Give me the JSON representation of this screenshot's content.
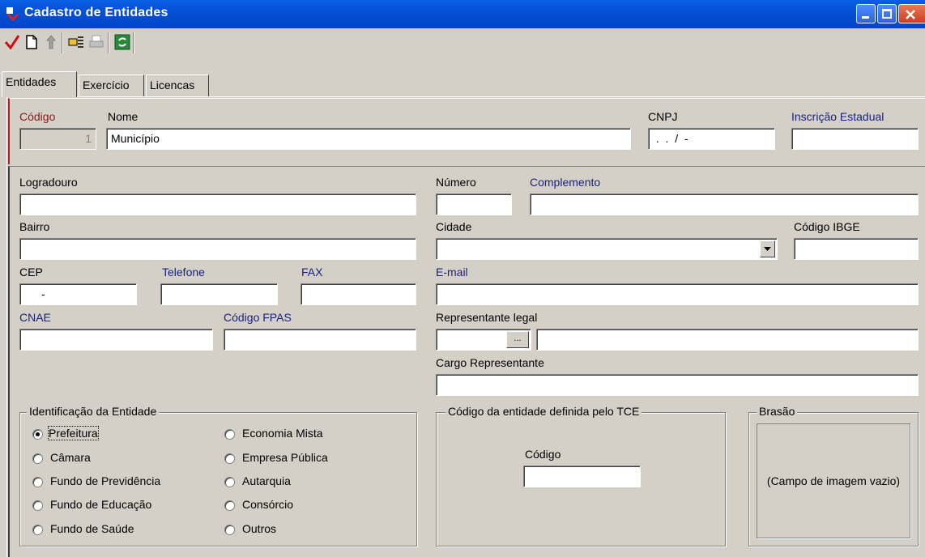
{
  "window": {
    "title": "Cadastro de Entidades",
    "titlebar_color": "#0050d0"
  },
  "toolbar": {
    "icons": [
      "checkmark-icon",
      "new-document-icon",
      "delete-icon",
      "search-icon",
      "print-icon",
      "refresh-icon"
    ]
  },
  "tabs": [
    {
      "label": "Entidades",
      "active": true
    },
    {
      "label": "Exercício",
      "active": false
    },
    {
      "label": "Licencas",
      "active": false
    }
  ],
  "header": {
    "codigo_label": "Código",
    "codigo_value": "1",
    "nome_label": "Nome",
    "nome_value": "Município",
    "cnpj_label": "CNPJ",
    "cnpj_value": " .  .  /  -",
    "ie_label": "Inscrição Estadual",
    "ie_value": ""
  },
  "address": {
    "logradouro_label": "Logradouro",
    "numero_label": "Número",
    "complemento_label": "Complemento",
    "bairro_label": "Bairro",
    "cidade_label": "Cidade",
    "ibge_label": "Código IBGE",
    "cep_label": "CEP",
    "cep_value": "-",
    "telefone_label": "Telefone",
    "fax_label": "FAX",
    "email_label": "E-mail",
    "cnae_label": "CNAE",
    "fpas_label": "Código FPAS",
    "representante_label": "Representante legal",
    "lookup_button": "...",
    "cargo_label": "Cargo Representante"
  },
  "identificacao": {
    "legend": "Identificação da Entidade",
    "options_left": [
      "Prefeitura",
      "Câmara",
      "Fundo de Previdência",
      "Fundo de Educação",
      "Fundo de Saúde"
    ],
    "options_right": [
      "Economia Mista",
      "Empresa Pública",
      "Autarquia",
      "Consórcio",
      "Outros"
    ],
    "selected": "Prefeitura"
  },
  "tce": {
    "legend": "Código da entidade definida pelo TCE",
    "codigo_label": "Código",
    "codigo_value": ""
  },
  "brasao": {
    "legend": "Brasão",
    "placeholder": "(Campo de imagem vazio)"
  }
}
